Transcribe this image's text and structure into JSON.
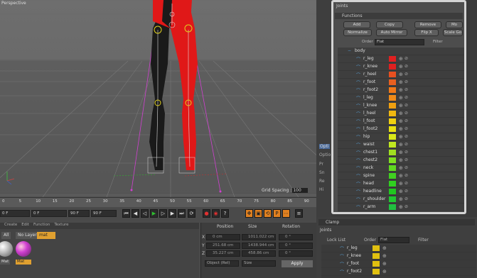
{
  "viewport": {
    "label": "Perspective",
    "grid_spacing_label": "Grid Spacing :",
    "grid_spacing_value": "100"
  },
  "timeline": {
    "ticks": [
      "0",
      "5",
      "10",
      "15",
      "20",
      "25",
      "30",
      "35",
      "40",
      "45",
      "50",
      "55",
      "60",
      "65",
      "70",
      "75",
      "80",
      "85",
      "90"
    ],
    "end_field": "0 F",
    "start_field": "0 F",
    "mid_field": "90 F",
    "end_field2": "90 F"
  },
  "transport": {
    "buttons": [
      "first",
      "prev",
      "back",
      "play",
      "forward",
      "next",
      "last",
      "record",
      "key",
      "autokey",
      "move",
      "scale",
      "rotate",
      "param",
      "pla",
      "timeline"
    ]
  },
  "material_manager": {
    "menu": [
      "Create",
      "Edit",
      "Function",
      "Texture"
    ],
    "chips": [
      "All",
      "No Layer",
      "mat"
    ],
    "materials": [
      {
        "name": "Mat",
        "color": "#bfbfbf"
      },
      {
        "name": "Mat",
        "color": "#d040d0"
      }
    ]
  },
  "coordinates": {
    "headers": [
      "Position",
      "Size",
      "Rotation"
    ],
    "rows": [
      {
        "axis": "X",
        "pos": "0 cm",
        "size": "1011.022 cm",
        "rot_axis": "H",
        "rot": "0 °"
      },
      {
        "axis": "Y",
        "pos": "251.68 cm",
        "size": "1438.944 cm",
        "rot_axis": "P",
        "rot": "0 °"
      },
      {
        "axis": "Z",
        "pos": "35.227 cm",
        "size": "458.86 cm",
        "rot_axis": "B",
        "rot": "0 °"
      }
    ],
    "mode_object": "Object (Rel)",
    "mode_size": "Size",
    "apply_label": "Apply"
  },
  "mid_strip": {
    "labels": [
      "Opti",
      "Optio",
      "Pr",
      "Sn",
      "Re",
      "Hi"
    ]
  },
  "joints_panel": {
    "title": "Joints",
    "section": "Functions",
    "buttons_row1": [
      "Add",
      "Copy",
      "Remove",
      "Mo"
    ],
    "buttons_row2": [
      "Normalize",
      "Auto Mirror",
      "Flip X",
      "Scale Go"
    ],
    "order_label": "Order",
    "order_value": "Flat",
    "filter_label": "Filter",
    "root_label": "body",
    "joints": [
      {
        "name": "r_leg",
        "color": "#e02020"
      },
      {
        "name": "r_knee",
        "color": "#e02020"
      },
      {
        "name": "r_heel",
        "color": "#e85020"
      },
      {
        "name": "r_foot",
        "color": "#e86020"
      },
      {
        "name": "r_foot2",
        "color": "#f07818"
      },
      {
        "name": "l_leg",
        "color": "#f08a18"
      },
      {
        "name": "l_knee",
        "color": "#f0a010"
      },
      {
        "name": "l_heel",
        "color": "#f0b810"
      },
      {
        "name": "l_foot",
        "color": "#f0d010"
      },
      {
        "name": "l_foot2",
        "color": "#e8e010"
      },
      {
        "name": "hip",
        "color": "#d8e818"
      },
      {
        "name": "waist",
        "color": "#c0e820"
      },
      {
        "name": "chest1",
        "color": "#a0e020"
      },
      {
        "name": "chest2",
        "color": "#80e020"
      },
      {
        "name": "neck",
        "color": "#60d820"
      },
      {
        "name": "spine",
        "color": "#40d020"
      },
      {
        "name": "head",
        "color": "#30d020"
      },
      {
        "name": "headline",
        "color": "#20c820"
      },
      {
        "name": "r_shoulder",
        "color": "#20c830"
      },
      {
        "name": "r_arm",
        "color": "#20c040"
      }
    ]
  },
  "lower_panel": {
    "section1": "Clamp",
    "section2": "Joints",
    "lock_list": "Lock List",
    "order_label": "Order",
    "order_value": "Flat",
    "filter_label": "Filter",
    "items": [
      {
        "name": "r_leg",
        "color": "#e0c010"
      },
      {
        "name": "r_knee",
        "color": "#e0c010"
      },
      {
        "name": "r_foot",
        "color": "#e0c010"
      },
      {
        "name": "r_foot2",
        "color": "#e0c010"
      }
    ]
  }
}
